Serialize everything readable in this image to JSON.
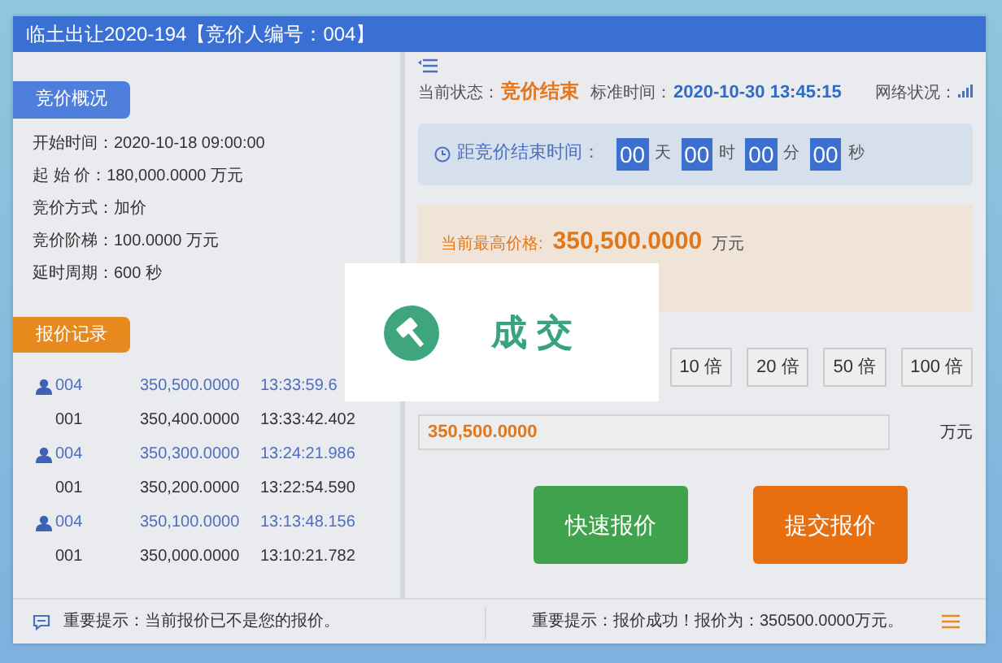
{
  "window": {
    "title": "临土出让2020-194【竞价人编号：004】"
  },
  "overview": {
    "heading": "竞价概况",
    "fields": [
      {
        "label": "开始时间：",
        "value": "2020-10-18 09:00:00"
      },
      {
        "label": "起 始 价：",
        "value": "180,000.0000 万元"
      },
      {
        "label": "竞价方式：",
        "value": "加价"
      },
      {
        "label": "竞价阶梯：",
        "value": "100.0000 万元"
      },
      {
        "label": "延时周期：",
        "value": "600 秒"
      }
    ]
  },
  "records": {
    "heading": "报价记录",
    "rows": [
      {
        "own": true,
        "bidder": "004",
        "price": "350,500.0000",
        "time": "13:33:59.6"
      },
      {
        "own": false,
        "bidder": "001",
        "price": "350,400.0000",
        "time": "13:33:42.402"
      },
      {
        "own": true,
        "bidder": "004",
        "price": "350,300.0000",
        "time": "13:24:21.986"
      },
      {
        "own": false,
        "bidder": "001",
        "price": "350,200.0000",
        "time": "13:22:54.590"
      },
      {
        "own": true,
        "bidder": "004",
        "price": "350,100.0000",
        "time": "13:13:48.156"
      },
      {
        "own": false,
        "bidder": "001",
        "price": "350,000.0000",
        "time": "13:10:21.782"
      }
    ]
  },
  "status": {
    "state_label": "当前状态：",
    "state": "竞价结束",
    "time_label": "标准时间：",
    "time": "2020-10-30 13:45:15",
    "network_label": "网络状况："
  },
  "countdown": {
    "label": "距竞价结束时间：",
    "units": [
      {
        "value": "00",
        "unit": "天"
      },
      {
        "value": "00",
        "unit": "时"
      },
      {
        "value": "00",
        "unit": "分"
      },
      {
        "value": "00",
        "unit": "秒"
      }
    ]
  },
  "highest": {
    "label": "当前最高价格:",
    "price": "350,500.0000",
    "unit": "万元"
  },
  "multipliers": [
    "10 倍",
    "20 倍",
    "50 倍",
    "100 倍"
  ],
  "bid_input": {
    "value": "350,500.0000",
    "unit": "万元"
  },
  "buttons": [
    {
      "kind": "quick",
      "label": "快速报价"
    },
    {
      "kind": "submit",
      "label": "提交报价"
    }
  ],
  "footer": {
    "left": "重要提示：当前报价已不是您的报价。",
    "right": "重要提示：报价成功！报价为：350500.0000万元。"
  },
  "popup": {
    "text": "成交"
  }
}
